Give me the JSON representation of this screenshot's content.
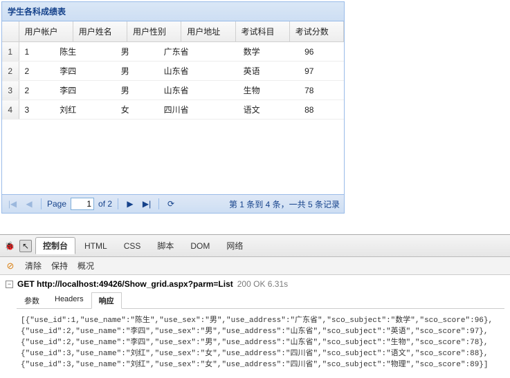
{
  "panel": {
    "title": "学生各科成绩表"
  },
  "grid": {
    "columns": [
      "用户帐户",
      "用户姓名",
      "用户性别",
      "用户地址",
      "考试科目",
      "考试分数"
    ],
    "rows": [
      {
        "n": "1",
        "c": [
          "1",
          "陈生",
          "男",
          "广东省",
          "数学",
          "96"
        ]
      },
      {
        "n": "2",
        "c": [
          "2",
          "李四",
          "男",
          "山东省",
          "英语",
          "97"
        ]
      },
      {
        "n": "3",
        "c": [
          "2",
          "李四",
          "男",
          "山东省",
          "生物",
          "78"
        ]
      },
      {
        "n": "4",
        "c": [
          "3",
          "刘红",
          "女",
          "四川省",
          "语文",
          "88"
        ]
      }
    ]
  },
  "paging": {
    "page_label": "Page",
    "page_value": "1",
    "of_label": "of 2",
    "first": "|◀",
    "prev": "◀",
    "next": "▶",
    "last": "▶|",
    "refresh": "⟳",
    "status": "第 1 条到 4 条，一共 5 条记录"
  },
  "dev": {
    "bug": "🐞",
    "cursor": "↖",
    "tabs": [
      "控制台",
      "HTML",
      "CSS",
      "脚本",
      "DOM",
      "网络"
    ],
    "active_tab": 0,
    "sub_cmds": [
      "清除",
      "保持",
      "概况"
    ],
    "request": {
      "method": "GET",
      "url": "http://localhost:49426/Show_grid.aspx?parm=List",
      "status": "200 OK 6.31s"
    },
    "resp_tabs": [
      "参数",
      "Headers",
      "响应"
    ],
    "resp_active": 2,
    "response_body": "[{\"use_id\":1,\"use_name\":\"陈生\",\"use_sex\":\"男\",\"use_address\":\"广东省\",\"sco_subject\":\"数学\",\"sco_score\":96},{\"use_id\":2,\"use_name\":\"李四\",\"use_sex\":\"男\",\"use_address\":\"山东省\",\"sco_subject\":\"英语\",\"sco_score\":97},{\"use_id\":2,\"use_name\":\"李四\",\"use_sex\":\"男\",\"use_address\":\"山东省\",\"sco_subject\":\"生物\",\"sco_score\":78},{\"use_id\":3,\"use_name\":\"刘红\",\"use_sex\":\"女\",\"use_address\":\"四川省\",\"sco_subject\":\"语文\",\"sco_score\":88},{\"use_id\":3,\"use_name\":\"刘红\",\"use_sex\":\"女\",\"use_address\":\"四川省\",\"sco_subject\":\"物理\",\"sco_score\":89}]"
  }
}
